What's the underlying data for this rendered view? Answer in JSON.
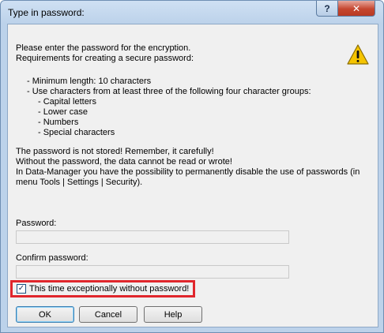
{
  "window": {
    "title": "Type in password:",
    "help_glyph": "?",
    "close_glyph": "✕"
  },
  "icons": {
    "warning": "warning-icon"
  },
  "message": {
    "intro": [
      "Please enter the password for the encryption.",
      "Requirements for creating a secure password:"
    ],
    "requirements": [
      "- Minimum length: 10 characters",
      "- Use characters from at least three of the following four character groups:"
    ],
    "groups": [
      "- Capital letters",
      "- Lower case",
      "- Numbers",
      "- Special characters"
    ],
    "notes": [
      "The password is not stored! Remember, it carefully!",
      "Without the password, the data cannot be read or wrote!",
      "In Data-Manager you have the possibility to permanently disable the use of passwords (in",
      "menu Tools | Settings | Security)."
    ]
  },
  "form": {
    "password_label": "Password:",
    "password_value": "",
    "confirm_label": "Confirm password:",
    "confirm_value": "",
    "checkbox_label": "This time exceptionally without  password!",
    "checkbox_checked": true,
    "checkbox_mark": "✓"
  },
  "buttons": {
    "ok": "OK",
    "cancel": "Cancel",
    "help": "Help"
  },
  "colors": {
    "highlight_border": "#e0262c",
    "warning_fill": "#f5c400"
  }
}
